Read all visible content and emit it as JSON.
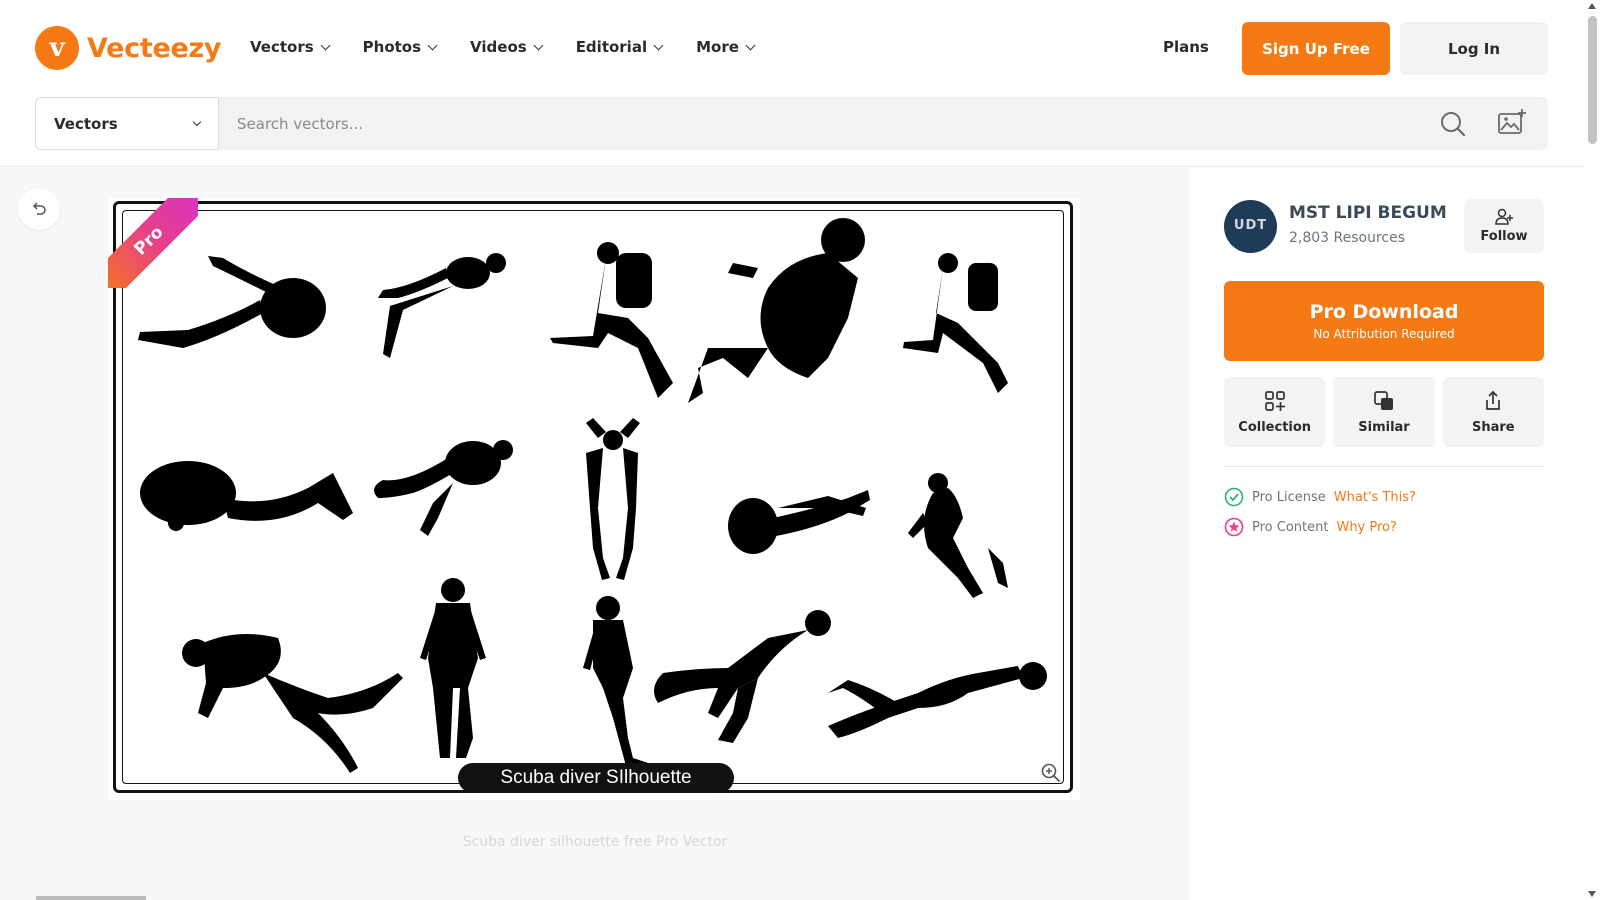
{
  "brand": {
    "name": "Vecteezy",
    "color": "#f57a14"
  },
  "nav": {
    "items": [
      {
        "label": "Vectors"
      },
      {
        "label": "Photos"
      },
      {
        "label": "Videos"
      },
      {
        "label": "Editorial"
      },
      {
        "label": "More"
      }
    ],
    "plans": "Plans",
    "signup": "Sign Up Free",
    "login": "Log In"
  },
  "search": {
    "type": "Vectors",
    "placeholder": "Search vectors...",
    "value": ""
  },
  "preview": {
    "badge": "Pro",
    "caption": "Scuba diver SIlhouette",
    "title": "Scuba diver silhouette free Pro Vector"
  },
  "author": {
    "name": "MST LIPI BEGUM",
    "resources": "2,803 Resources",
    "follow": "Follow"
  },
  "download": {
    "label": "Pro Download",
    "sublabel": "No Attribution Required"
  },
  "actions": [
    {
      "label": "Collection",
      "icon": "collection-icon"
    },
    {
      "label": "Similar",
      "icon": "similar-icon"
    },
    {
      "label": "Share",
      "icon": "share-icon"
    }
  ],
  "license": [
    {
      "label": "Pro License",
      "link": "What's This?",
      "icon": "check-circle-icon",
      "color": "#2fb36c"
    },
    {
      "label": "Pro Content",
      "link": "Why Pro?",
      "icon": "star-circle-icon",
      "color": "#e83e8c"
    }
  ],
  "colors": {
    "accent": "#f57a14",
    "pro_pink": "#e83e8c"
  }
}
